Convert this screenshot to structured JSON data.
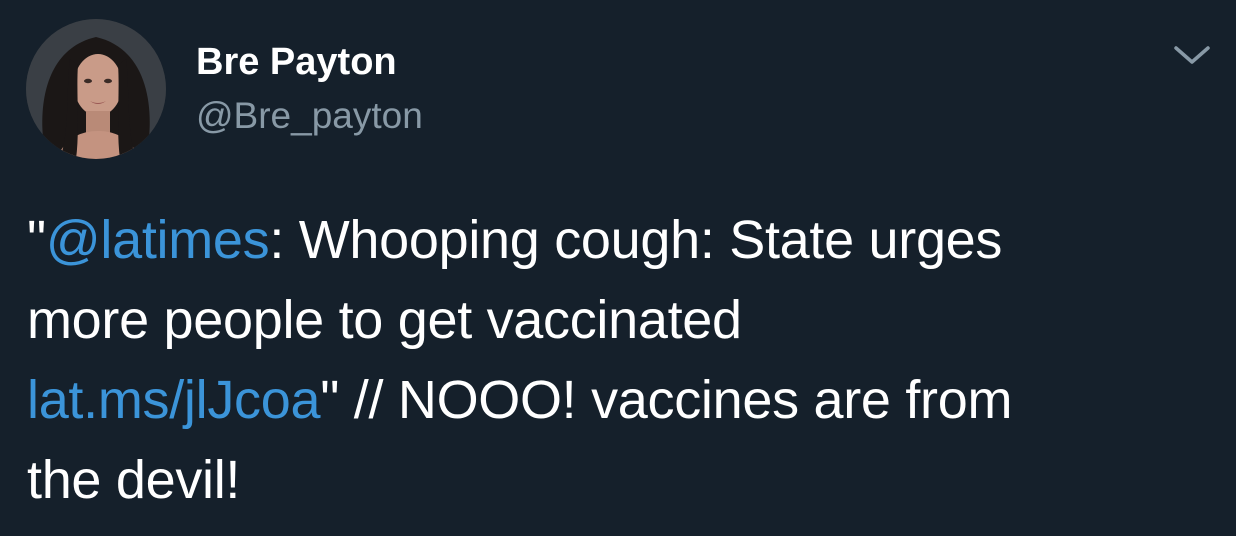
{
  "tweet": {
    "author": {
      "display_name": "Bre Payton",
      "handle": "@Bre_payton"
    },
    "menu_icon": "chevron-down-icon",
    "body": {
      "quote_open": "\"",
      "mention": "@latimes",
      "line1_rest": ": Whooping cough: State urges",
      "line2": "more people to get vaccinated",
      "link": "lat.ms/jlJcoa",
      "line3_rest": "\" // NOOO! vaccines are from",
      "line4": "the devil!"
    }
  },
  "colors": {
    "background": "#15202b",
    "text": "#ffffff",
    "secondary_text": "#8899a6",
    "link": "#3b94d9"
  }
}
